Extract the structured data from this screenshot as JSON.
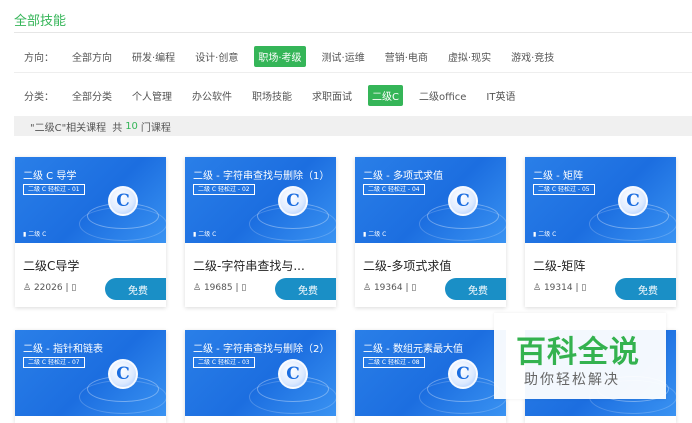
{
  "page_title": "全部技能",
  "direction": {
    "label": "方向：",
    "items": [
      "全部方向",
      "研发·编程",
      "设计·创意",
      "职场·考级",
      "测试·运维",
      "营销·电商",
      "虚拟·现实",
      "游戏·竞技"
    ],
    "active": "职场·考级"
  },
  "category": {
    "label": "分类：",
    "items": [
      "全部分类",
      "个人管理",
      "办公软件",
      "职场技能",
      "求职面试",
      "二级C",
      "二级office",
      "IT英语"
    ],
    "active": "二级C"
  },
  "summary": {
    "prefix": "\"二级C\"相关课程",
    "count_prefix": "共",
    "count": "10",
    "count_suffix": "门课程"
  },
  "courses": [
    {
      "banner_title": "二级 C 导学",
      "banner_tag": "二级 C 轻松过 - 01",
      "banner_foot": "二级 C",
      "name": "二级C导学",
      "students": "22026",
      "button": "免费"
    },
    {
      "banner_title": "二级 - 字符串查找与删除（1）",
      "banner_tag": "二级 C 轻松过 - 02",
      "banner_foot": "二级 C",
      "name": "二级-字符串查找与...",
      "students": "19685",
      "button": "免费"
    },
    {
      "banner_title": "二级 - 多项式求值",
      "banner_tag": "二级 C 轻松过 - 04",
      "banner_foot": "二级 C",
      "name": "二级-多项式求值",
      "students": "19364",
      "button": "免费"
    },
    {
      "banner_title": "二级 - 矩阵",
      "banner_tag": "二级 C 轻松过 - 05",
      "banner_foot": "二级 C",
      "name": "二级-矩阵",
      "students": "19314",
      "button": "免费"
    },
    {
      "banner_title": "二级 - 指针和链表",
      "banner_tag": "二级 C 轻松过 - 07",
      "banner_foot": "",
      "name": "",
      "students": "",
      "button": ""
    },
    {
      "banner_title": "二级 - 字符串查找与删除（2）",
      "banner_tag": "二级 C 轻松过 - 03",
      "banner_foot": "",
      "name": "",
      "students": "",
      "button": ""
    },
    {
      "banner_title": "二级 - 数组元素最大值",
      "banner_tag": "二级 C 轻松过 - 08",
      "banner_foot": "",
      "name": "",
      "students": "",
      "button": ""
    }
  ],
  "watermark": {
    "big": "百科全说",
    "small": "助你轻松解决"
  },
  "colors": {
    "accent": "#35b558",
    "button": "#1a8fc6",
    "banner": "#1c6ee0"
  }
}
